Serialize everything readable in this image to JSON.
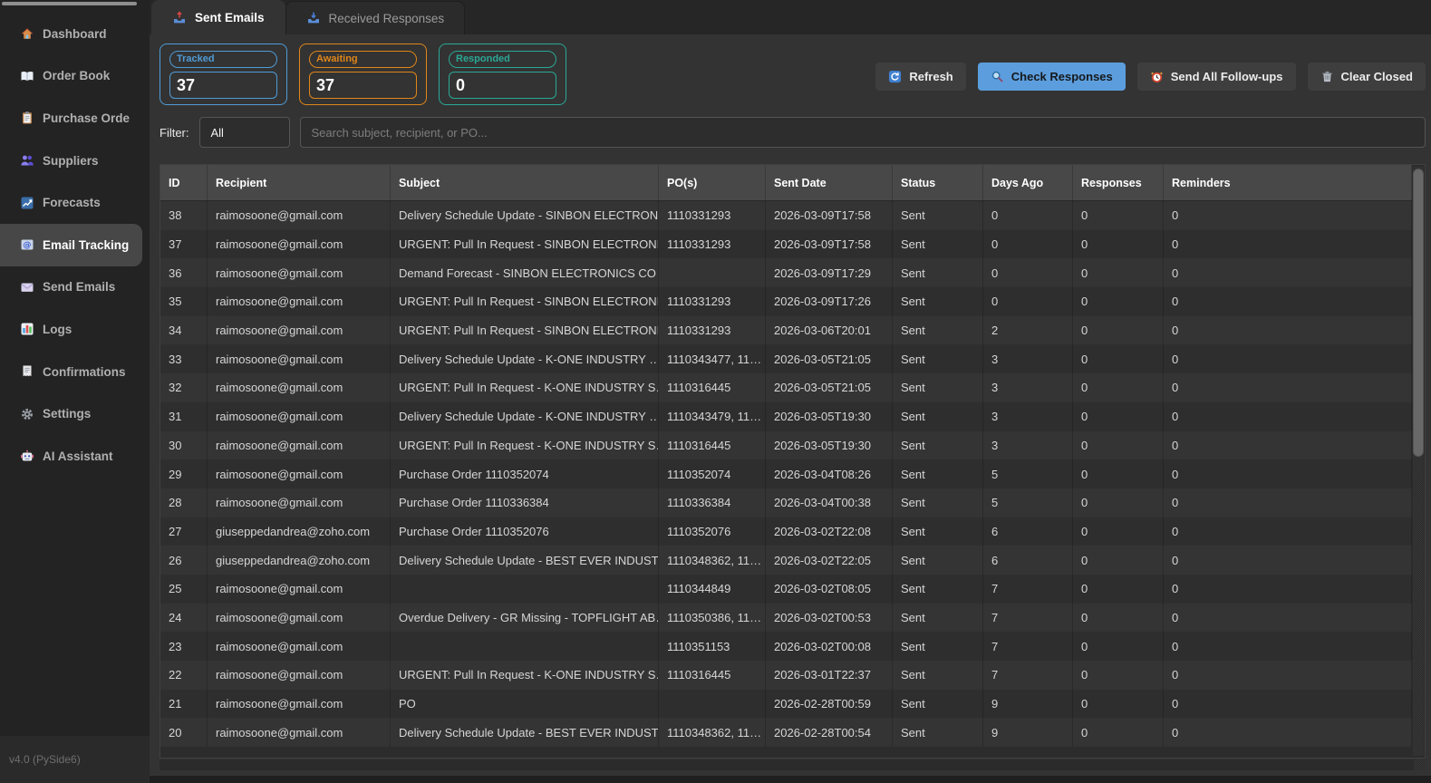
{
  "app": {
    "version_label": "v4.0 (PySide6)"
  },
  "sidebar": {
    "items": [
      {
        "label": "Dashboard",
        "icon": "dashboard-icon",
        "active": false
      },
      {
        "label": "Order Book",
        "icon": "order-book-icon",
        "active": false
      },
      {
        "label": "Purchase Orde",
        "icon": "purchase-orders-icon",
        "active": false
      },
      {
        "label": "Suppliers",
        "icon": "suppliers-icon",
        "active": false
      },
      {
        "label": "Forecasts",
        "icon": "forecasts-icon",
        "active": false
      },
      {
        "label": "Email Tracking",
        "icon": "email-tracking-icon",
        "active": true
      },
      {
        "label": "Send Emails",
        "icon": "send-emails-icon",
        "active": false
      },
      {
        "label": "Logs",
        "icon": "logs-icon",
        "active": false
      },
      {
        "label": "Confirmations",
        "icon": "confirmations-icon",
        "active": false
      },
      {
        "label": "Settings",
        "icon": "settings-icon",
        "active": false
      },
      {
        "label": "AI Assistant",
        "icon": "ai-assistant-icon",
        "active": false
      }
    ]
  },
  "tabs": [
    {
      "label": "Sent Emails",
      "icon": "outbox-icon",
      "active": true
    },
    {
      "label": "Received Responses",
      "icon": "inbox-icon",
      "active": false
    }
  ],
  "stats": {
    "boxes": [
      {
        "label": "Tracked",
        "value": "37",
        "color": "#4f9bd5"
      },
      {
        "label": "Awaiting",
        "value": "37",
        "color": "#e0861a"
      },
      {
        "label": "Responded",
        "value": "0",
        "color": "#2aa896"
      }
    ]
  },
  "toolbar": {
    "buttons": [
      {
        "label": "Refresh",
        "icon": "refresh-icon",
        "primary": false
      },
      {
        "label": "Check Responses",
        "icon": "search-icon",
        "primary": true
      },
      {
        "label": "Send All Follow-ups",
        "icon": "alarm-icon",
        "primary": false
      },
      {
        "label": "Clear Closed",
        "icon": "trash-icon",
        "primary": false
      }
    ]
  },
  "filter": {
    "label": "Filter:",
    "selected": "All",
    "search_placeholder": "Search subject, recipient, or PO..."
  },
  "table": {
    "columns": [
      "ID",
      "Recipient",
      "Subject",
      "PO(s)",
      "Sent Date",
      "Status",
      "Days Ago",
      "Responses",
      "Reminders"
    ],
    "rows": [
      [
        "38",
        "raimosoone@gmail.com",
        "Delivery Schedule Update - SINBON ELECTRON…",
        "1110331293",
        "2026-03-09T17:58",
        "Sent",
        "0",
        "0",
        "0"
      ],
      [
        "37",
        "raimosoone@gmail.com",
        "URGENT: Pull In Request - SINBON ELECTRONI…",
        "1110331293",
        "2026-03-09T17:58",
        "Sent",
        "0",
        "0",
        "0"
      ],
      [
        "36",
        "raimosoone@gmail.com",
        "Demand Forecast - SINBON ELECTRONICS CO …",
        "",
        "2026-03-09T17:29",
        "Sent",
        "0",
        "0",
        "0"
      ],
      [
        "35",
        "raimosoone@gmail.com",
        "URGENT: Pull In Request - SINBON ELECTRONI…",
        "1110331293",
        "2026-03-09T17:26",
        "Sent",
        "0",
        "0",
        "0"
      ],
      [
        "34",
        "raimosoone@gmail.com",
        "URGENT: Pull In Request - SINBON ELECTRONI…",
        "1110331293",
        "2026-03-06T20:01",
        "Sent",
        "2",
        "0",
        "0"
      ],
      [
        "33",
        "raimosoone@gmail.com",
        "Delivery Schedule Update - K-ONE INDUSTRY …",
        "1110343477, 11…",
        "2026-03-05T21:05",
        "Sent",
        "3",
        "0",
        "0"
      ],
      [
        "32",
        "raimosoone@gmail.com",
        "URGENT: Pull In Request - K-ONE INDUSTRY S…",
        "1110316445",
        "2026-03-05T21:05",
        "Sent",
        "3",
        "0",
        "0"
      ],
      [
        "31",
        "raimosoone@gmail.com",
        "Delivery Schedule Update - K-ONE INDUSTRY …",
        "1110343479, 11…",
        "2026-03-05T19:30",
        "Sent",
        "3",
        "0",
        "0"
      ],
      [
        "30",
        "raimosoone@gmail.com",
        "URGENT: Pull In Request - K-ONE INDUSTRY S…",
        "1110316445",
        "2026-03-05T19:30",
        "Sent",
        "3",
        "0",
        "0"
      ],
      [
        "29",
        "raimosoone@gmail.com",
        "Purchase Order 1110352074",
        "1110352074",
        "2026-03-04T08:26",
        "Sent",
        "5",
        "0",
        "0"
      ],
      [
        "28",
        "raimosoone@gmail.com",
        "Purchase Order 1110336384",
        "1110336384",
        "2026-03-04T00:38",
        "Sent",
        "5",
        "0",
        "0"
      ],
      [
        "27",
        "giuseppedandrea@zoho.com",
        "Purchase Order 1110352076",
        "1110352076",
        "2026-03-02T22:08",
        "Sent",
        "6",
        "0",
        "0"
      ],
      [
        "26",
        "giuseppedandrea@zoho.com",
        "Delivery Schedule Update - BEST EVER INDUST…",
        "1110348362, 11…",
        "2026-03-02T22:05",
        "Sent",
        "6",
        "0",
        "0"
      ],
      [
        "25",
        "raimosoone@gmail.com",
        "",
        "1110344849",
        "2026-03-02T08:05",
        "Sent",
        "7",
        "0",
        "0"
      ],
      [
        "24",
        "raimosoone@gmail.com",
        "Overdue Delivery - GR Missing - TOPFLIGHT AB…",
        "1110350386, 11…",
        "2026-03-02T00:53",
        "Sent",
        "7",
        "0",
        "0"
      ],
      [
        "23",
        "raimosoone@gmail.com",
        "",
        "1110351153",
        "2026-03-02T00:08",
        "Sent",
        "7",
        "0",
        "0"
      ],
      [
        "22",
        "raimosoone@gmail.com",
        "URGENT: Pull In Request - K-ONE INDUSTRY S…",
        "1110316445",
        "2026-03-01T22:37",
        "Sent",
        "7",
        "0",
        "0"
      ],
      [
        "21",
        "raimosoone@gmail.com",
        "PO",
        "",
        "2026-02-28T00:59",
        "Sent",
        "9",
        "0",
        "0"
      ],
      [
        "20",
        "raimosoone@gmail.com",
        "Delivery Schedule Update - BEST EVER INDUST…",
        "1110348362, 11…",
        "2026-02-28T00:54",
        "Sent",
        "9",
        "0",
        "0"
      ]
    ]
  }
}
